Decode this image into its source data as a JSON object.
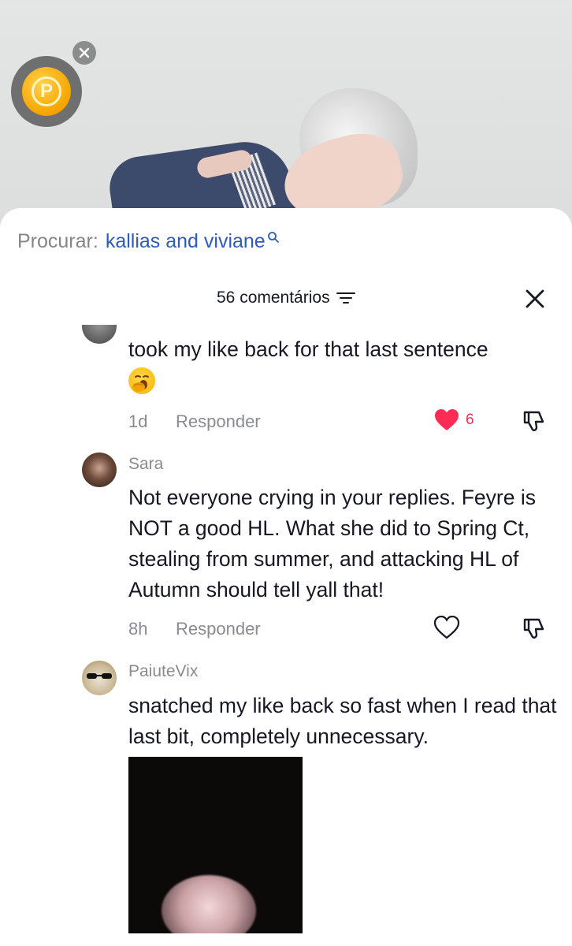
{
  "search": {
    "prefix": "Procurar:",
    "query": "kallias and viviane"
  },
  "header": {
    "count_label": "56 comentários"
  },
  "comments": [
    {
      "user": "",
      "text": "took my like back for that last sentence",
      "emoji": "yawning-face",
      "time": "1d",
      "reply_label": "Responder",
      "liked": true,
      "like_count": "6"
    },
    {
      "user": "Sara",
      "text": "Not everyone crying in your replies. Feyre is NOT a good HL. What she did to Spring Ct, stealing from summer, and attacking HL of Autumn should tell yall that!",
      "time": "8h",
      "reply_label": "Responder",
      "liked": false
    },
    {
      "user": "PaiuteVix",
      "text": "snatched my like back so fast when I read that last bit, completely unnecessary.",
      "has_media": true
    }
  ],
  "colors": {
    "like_red": "#fe2c55",
    "link_blue": "#2f5bb7",
    "coin_gold": "#f5a400"
  }
}
